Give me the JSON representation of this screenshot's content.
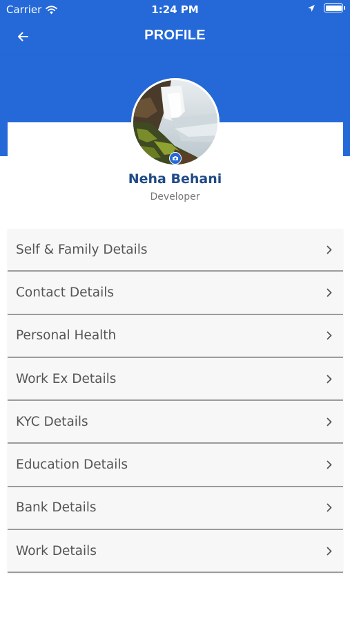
{
  "status_bar": {
    "carrier": "Carrier",
    "time": "1:24 PM"
  },
  "nav": {
    "title": "PROFILE",
    "back_icon": "arrow-left-icon"
  },
  "profile": {
    "name": "Neha Behani",
    "role": "Developer",
    "avatar": "waterfall landscape photo",
    "camera_icon": "camera-icon"
  },
  "menu": [
    {
      "label": "Self & Family Details"
    },
    {
      "label": "Contact Details"
    },
    {
      "label": "Personal Health"
    },
    {
      "label": "Work Ex Details"
    },
    {
      "label": "KYC Details"
    },
    {
      "label": "Education Details"
    },
    {
      "label": "Bank Details"
    },
    {
      "label": "Work Details"
    }
  ],
  "colors": {
    "primary": "#2569d8",
    "name": "#1f4a86",
    "menu_bg": "#f7f7f7",
    "menu_text": "#555555",
    "divider": "#9c9c9c"
  }
}
